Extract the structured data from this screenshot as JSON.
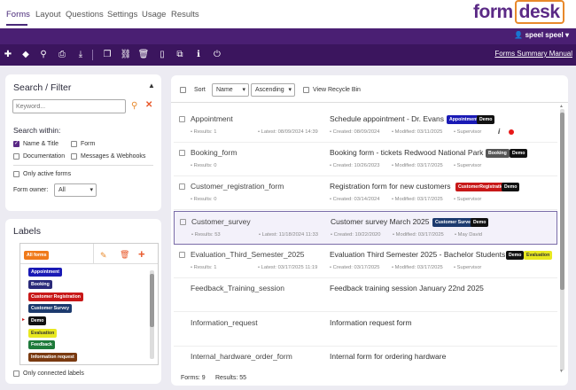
{
  "nav": {
    "tabs": [
      "Forms",
      "Layout",
      "Questions",
      "Settings",
      "Usage",
      "Results"
    ],
    "logo_left": "form",
    "logo_right": "desk"
  },
  "user": {
    "name": "speel speel"
  },
  "toolbar": {
    "icons": [
      "plus-icon",
      "tag-icon",
      "search-icon",
      "print-icon",
      "download-icon",
      "copy-icon",
      "link-icon",
      "trash-icon",
      "clipboard-icon",
      "duplicate-icon",
      "info-icon",
      "power-icon"
    ],
    "manual_label": "Forms Summary Manual"
  },
  "search": {
    "title": "Search / Filter",
    "keyword_placeholder": "Keyword...",
    "within_label": "Search within:",
    "opt_name_title": "Name & Title",
    "opt_form": "Form",
    "opt_documentation": "Documentation",
    "opt_messages": "Messages & Webhooks",
    "only_active": "Only active forms",
    "owner_label": "Form owner:",
    "owner_value": "All"
  },
  "labels": {
    "title": "Labels",
    "items": [
      {
        "name": "All forms",
        "color": "#f07a1a"
      },
      {
        "name": "Appointment",
        "color": "#1a1ab5"
      },
      {
        "name": "Booking",
        "color": "#2a2a7a"
      },
      {
        "name": "Customer Registration",
        "color": "#c81818"
      },
      {
        "name": "Customer Survey",
        "color": "#1c3a6e"
      },
      {
        "name": "Demo",
        "color": "#111111"
      },
      {
        "name": "Evaluation",
        "color": "#e8e820"
      },
      {
        "name": "Feedback",
        "color": "#1e7a3a"
      },
      {
        "name": "Information request",
        "color": "#7a3a10"
      }
    ],
    "only_connected": "Only connected labels"
  },
  "list": {
    "sort_label": "Sort",
    "sort_field": "Name",
    "sort_order": "Ascending",
    "recycle_bin": "View Recycle Bin",
    "rows": [
      {
        "name": "Appointment",
        "desc": "Schedule appointment - Dr. Evans",
        "results": "Results: 1",
        "latest": "Latest: 08/09/2024 14:39",
        "created": "Created: 08/09/2024",
        "modified": "Modified: 03/11/2025",
        "owner": "Supervisor",
        "tags": [
          "Appointment",
          "Demo"
        ]
      },
      {
        "name": "Booking_form",
        "desc": "Booking form - tickets Redwood National Park",
        "results": "Results: 0",
        "latest": "",
        "created": "Created: 10/26/2023",
        "modified": "Modified: 03/17/2025",
        "owner": "Supervisor",
        "tags": [
          "Booking",
          "Demo"
        ]
      },
      {
        "name": "Customer_registration_form",
        "desc": "Registration form for new customers",
        "results": "Results: 0",
        "latest": "",
        "created": "Created: 03/14/2024",
        "modified": "Modified: 03/17/2025",
        "owner": "Supervisor",
        "tags": [
          "CustomerRegistration",
          "Demo"
        ]
      },
      {
        "name": "Customer_survey",
        "desc": "Customer survey March 2025",
        "results": "Results: 53",
        "latest": "Latest: 11/18/2024 11:33",
        "created": "Created: 10/22/2020",
        "modified": "Modified: 03/17/2025",
        "owner": "May David",
        "tags": [
          "Customer Survey",
          "Demo"
        ]
      },
      {
        "name": "Evaluation_Third_Semester_2025",
        "desc": "Evaluation Third Semester 2025 - Bachelor Students",
        "results": "Results: 1",
        "latest": "Latest: 03/17/2025 11:19",
        "created": "Created: 03/17/2025",
        "modified": "Modified: 03/17/2025",
        "owner": "Supervisor",
        "tags": [
          "Demo",
          "Evaluation"
        ]
      },
      {
        "name": "Feedback_Training_session",
        "desc": "Feedback training session January 22nd 2025",
        "results": "",
        "latest": "",
        "created": "",
        "modified": "",
        "owner": "",
        "tags": []
      },
      {
        "name": "Information_request",
        "desc": "Information request form",
        "results": "",
        "latest": "",
        "created": "",
        "modified": "",
        "owner": "",
        "tags": []
      },
      {
        "name": "Internal_hardware_order_form",
        "desc": "Internal form for ordering hardware",
        "results": "",
        "latest": "",
        "created": "",
        "modified": "",
        "owner": "",
        "tags": []
      }
    ],
    "forms_count": "Forms: 9",
    "results_count": "Results: 55"
  }
}
